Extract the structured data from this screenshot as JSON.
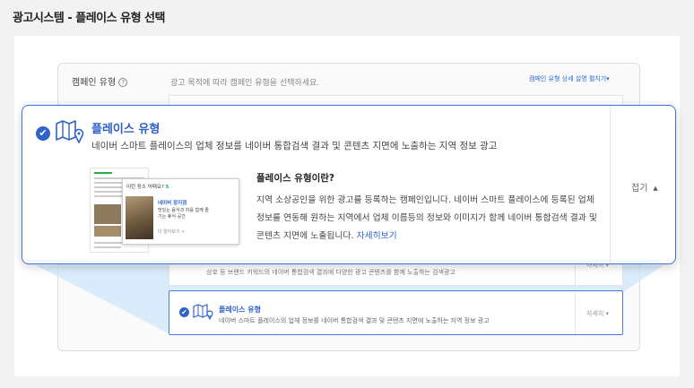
{
  "page_title": "광고시스템 - 플레이스 유형 선택",
  "campaign": {
    "label": "캠페인 유형",
    "help_icon": "?",
    "description": "광고 목적에 따라 캠페인 유형을 선택하세요.",
    "detail_link": "캠페인 유형 상세 설명 펼치기▾"
  },
  "expanded_card": {
    "check_icon": "✔",
    "title": "플레이스 유형",
    "description": "네이버 스마트 플레이스의 업체 정보를 네이버 통합검색 결과 및 콘텐츠 지면에 노출하는 지역 정보 광고",
    "collapse_label": "접기",
    "collapse_caret": "▲",
    "info_title": "플레이스 유형이란?",
    "info_body": "지역 소상공인을 위한 광고를 등록하는 캠페인입니다. 네이버 스마트 플레이스에 등록된 업체 정보를 연동해 원하는 지역에서 업체 이름등의 정보와 이미지가 함께 네이버 통합검색 결과 및 콘텐츠 지면에 노출됩니다.",
    "info_link": "자세히보기",
    "preview": {
      "header": "이런 장소 어때요?",
      "header_number": "5",
      "place_name": "네이버 장지점",
      "place_desc": "맛있는 음식과 차를 함께 즐기는 휴식 공간",
      "more": "더 알아보기 >"
    }
  },
  "behind_row": {
    "text": "상호 등 브랜드 키워드의 네이버 통합검색 결과에 다양한 광고 콘텐츠를 함께 노출하는 검색광고",
    "more": "자세히 ▾"
  },
  "selected_card": {
    "check_icon": "✔",
    "title": "플레이스 유형",
    "description": "네이버 스마트 플레이스의 업체 정보를 네이버 통합검색 결과 및 콘텐츠 지면에 노출하는 지역 정보 광고",
    "more": "자세히 ▾"
  },
  "colors": {
    "accent": "#2f63c9",
    "border_accent": "#3d74db",
    "beam": "#cfe6fb"
  }
}
